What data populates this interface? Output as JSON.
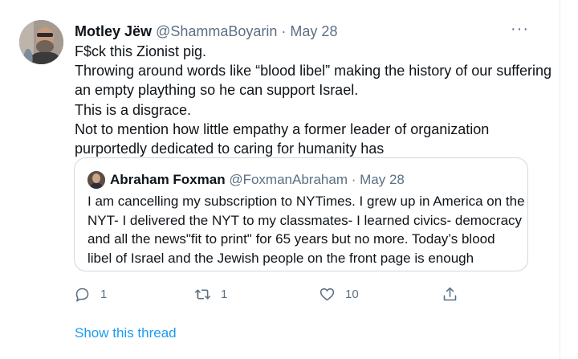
{
  "tweet": {
    "display_name": "Motley Jëw",
    "handle": "@ShammaBoyarin",
    "separator": "·",
    "date": "May 28",
    "more_label": "···",
    "lines": [
      "F$ck this Zionist pig.",
      "Throwing around words like “blood libel” making the history of our suffering",
      "an empty plaything so he can support Israel.",
      "This is a disgrace.",
      "Not to mention how little empathy a former leader of organization",
      "purportedly dedicated to caring for humanity has"
    ]
  },
  "quoted_tweet": {
    "display_name": "Abraham Foxman",
    "handle": "@FoxmanAbraham",
    "separator": "·",
    "date": "May 28",
    "lines": [
      "I am cancelling my subscription to NYTimes. I grew up in America on the",
      "NYT- I delivered the NYT to my classmates- I learned civics- democracy",
      "and all the  news\"fit to print\" for 65 years but no more. Today’s blood",
      "libel of Israel and the Jewish people on the front page is enough"
    ]
  },
  "actions": {
    "reply_count": "1",
    "retweet_count": "1",
    "like_count": "10",
    "icons": [
      "reply-icon",
      "retweet-icon",
      "like-icon",
      "share-icon"
    ]
  },
  "show_thread_label": "Show this thread",
  "colors": {
    "link": "#1d9bf0",
    "secondary_text": "#5b7083",
    "border": "#cfd9de"
  }
}
